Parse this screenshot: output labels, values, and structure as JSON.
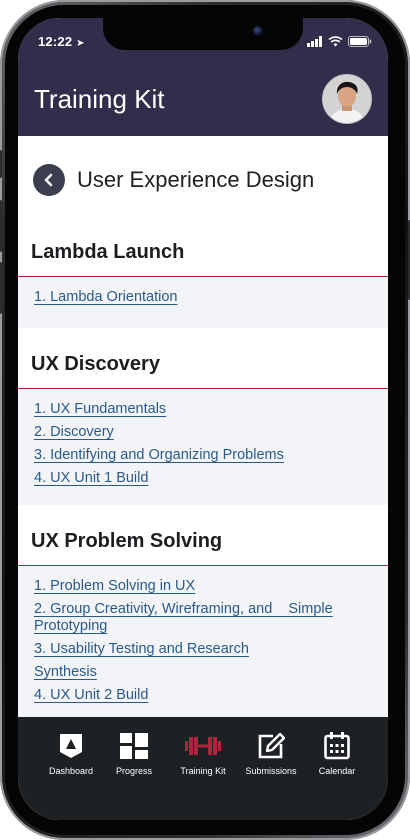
{
  "status_bar": {
    "time": "12:22"
  },
  "header": {
    "title": "Training Kit"
  },
  "page": {
    "title": "User Experience Design"
  },
  "sections": [
    {
      "title": "Lambda Launch",
      "items": [
        "1. Lambda Orientation"
      ]
    },
    {
      "title": "UX Discovery",
      "items": [
        "1. UX Fundamentals",
        "2. Discovery",
        "3. Identifying and Organizing Problems",
        "4. UX Unit 1 Build"
      ]
    },
    {
      "title": "UX Problem Solving",
      "items": [
        "1. Problem Solving in UX",
        "2. Group Creativity, Wireframing, and    Simple Prototyping",
        "3. Usability Testing and Research",
        "Synthesis",
        "4. UX Unit 2 Build"
      ]
    }
  ],
  "tabs": [
    {
      "label": "Dashboard",
      "icon": "dashboard-icon"
    },
    {
      "label": "Progress",
      "icon": "grid-icon"
    },
    {
      "label": "Training Kit",
      "icon": "dumbbell-icon",
      "active": true
    },
    {
      "label": "Submissions",
      "icon": "edit-icon"
    },
    {
      "label": "Calendar",
      "icon": "calendar-icon"
    }
  ],
  "colors": {
    "header_bg": "#312e4b",
    "section_rule": "#a8253b",
    "link": "#2a5a8c",
    "tabbar_bg": "#1e2124",
    "active_tab": "#b0253c"
  }
}
